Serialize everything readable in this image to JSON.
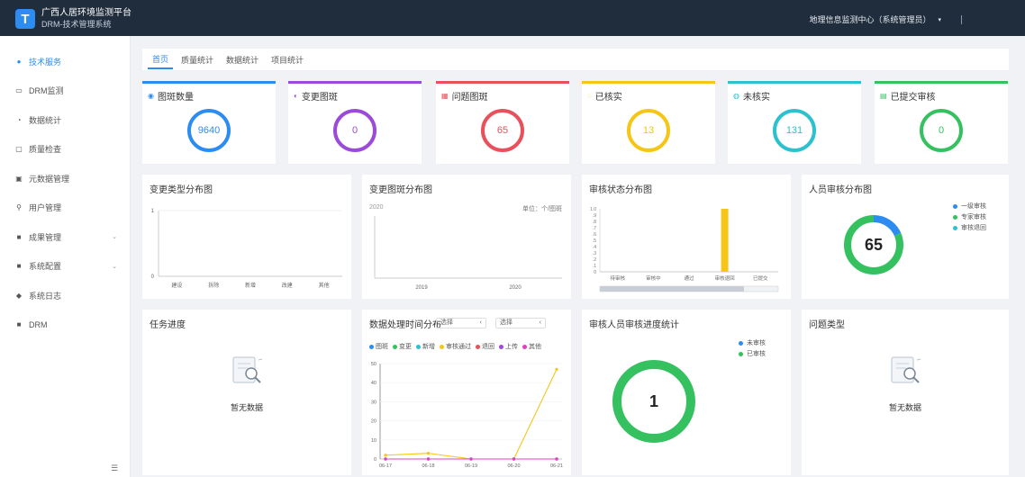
{
  "header": {
    "logo_letter": "T",
    "title_line1": "广西人居环境监测平台",
    "title_line2": "DRM-技术管理系统",
    "user_menu": "地理信息监测中心（系统管理员）",
    "caret": "▾"
  },
  "sidebar": {
    "items": [
      {
        "label": "技术服务",
        "icon": "home-icon",
        "glyph": "●",
        "active": true,
        "has_arrow": false
      },
      {
        "label": "DRM监测",
        "icon": "monitor-icon",
        "glyph": "▭",
        "active": false,
        "has_arrow": false
      },
      {
        "label": "数据统计",
        "icon": "chart-icon",
        "glyph": "◔",
        "active": false,
        "has_arrow": false
      },
      {
        "label": "质量检查",
        "icon": "check-icon",
        "glyph": "▢",
        "active": false,
        "has_arrow": false
      },
      {
        "label": "元数据管理",
        "icon": "database-icon",
        "glyph": "▣",
        "active": false,
        "has_arrow": false
      },
      {
        "label": "用户管理",
        "icon": "user-icon",
        "glyph": "⚲",
        "active": false,
        "has_arrow": false
      },
      {
        "label": "成果管理",
        "icon": "folder-icon",
        "glyph": "■",
        "active": false,
        "has_arrow": true
      },
      {
        "label": "系统配置",
        "icon": "settings-icon",
        "glyph": "■",
        "active": false,
        "has_arrow": true
      },
      {
        "label": "系统日志",
        "icon": "log-icon",
        "glyph": "◆",
        "active": false,
        "has_arrow": false
      },
      {
        "label": "DRM",
        "icon": "doc-icon",
        "glyph": "■",
        "active": false,
        "has_arrow": false
      }
    ],
    "arrow": "⌄",
    "collapse_glyph": "☰"
  },
  "tabs": [
    "首页",
    "质量统计",
    "数据统计",
    "项目统计"
  ],
  "stats": [
    {
      "title": "图斑数量",
      "value": "9640",
      "color": "#2d8cf0",
      "glyph": "◉"
    },
    {
      "title": "变更图斑",
      "value": "0",
      "color": "#9c4ad8",
      "glyph": "◐"
    },
    {
      "title": "问题图斑",
      "value": "65",
      "color": "#e8505b",
      "glyph": "▦"
    },
    {
      "title": "已核实",
      "value": "13",
      "color": "#f5c518",
      "glyph": "◌"
    },
    {
      "title": "未核实",
      "value": "131",
      "color": "#2bc1cf",
      "glyph": "◍"
    },
    {
      "title": "已提交审核",
      "value": "0",
      "color": "#35c160",
      "glyph": "▤"
    }
  ],
  "cards": {
    "c1_title": "变更类型分布图",
    "c2_title": "变更图斑分布图",
    "c2_note": "单位：个/图斑",
    "c2_top_label": "2020",
    "c3_title": "审核状态分布图",
    "c4_title": "人员审核分布图",
    "c5_title": "任务进度",
    "c6_title": "数据处理时间分布",
    "c6_select1": "选择",
    "c6_select2": "选择",
    "c6_select_caret": "‹",
    "c7_title": "审核人员审核进度统计",
    "c8_title": "问题类型",
    "empty_text": "暂无数据"
  },
  "chart_data": [
    {
      "type": "bar",
      "title": "变更类型分布图",
      "categories": [
        "建设",
        "拆除",
        "新增",
        "改建",
        "其他"
      ],
      "values": [
        0,
        0,
        0,
        0,
        0
      ],
      "ylim": [
        0,
        1
      ],
      "yticks": [
        "0",
        "1"
      ]
    },
    {
      "type": "bar",
      "title": "变更图斑分布图",
      "categories": [
        "2019",
        "2020"
      ],
      "values": [
        0,
        0
      ]
    },
    {
      "type": "bar",
      "title": "审核状态分布图",
      "categories": [
        "待审核",
        "审核中",
        "通过",
        "审核退回",
        "已提交"
      ],
      "values": [
        0,
        0,
        0,
        1,
        0
      ],
      "ylim": [
        0,
        1
      ],
      "yticks": [
        "0",
        ".1",
        ".2",
        ".3",
        ".4",
        ".5",
        ".6",
        ".7",
        ".8",
        ".9",
        "1.0"
      ],
      "bar_color": "#f5c518"
    },
    {
      "type": "pie",
      "title": "人员审核分布图",
      "center_label": "65",
      "series": [
        {
          "name": "一级审核",
          "value": 12,
          "color": "#2d8cf0"
        },
        {
          "name": "专家审核",
          "value": 53,
          "color": "#35c160"
        },
        {
          "name": "审核退回",
          "value": 0,
          "color": "#2bc1cf"
        }
      ]
    },
    {
      "type": "line",
      "title": "数据处理时间分布",
      "x": [
        "06-17",
        "06-18",
        "06-19",
        "06-20",
        "06-21"
      ],
      "ylim": [
        0,
        50
      ],
      "yticks": [
        "0",
        "10",
        "20",
        "30",
        "40",
        "50"
      ],
      "series": [
        {
          "name": "图斑",
          "color": "#2d8cf0",
          "values": [
            0,
            0,
            0,
            0,
            0
          ]
        },
        {
          "name": "变更",
          "color": "#35c160",
          "values": [
            0,
            0,
            0,
            0,
            0
          ]
        },
        {
          "name": "新增",
          "color": "#2bc1cf",
          "values": [
            0,
            0,
            0,
            0,
            0
          ]
        },
        {
          "name": "审核通过",
          "color": "#f5c518",
          "values": [
            2,
            3,
            0,
            0,
            47
          ]
        },
        {
          "name": "退回",
          "color": "#e8505b",
          "values": [
            0,
            0,
            0,
            0,
            0
          ]
        },
        {
          "name": "上传",
          "color": "#9c4ad8",
          "values": [
            0,
            0,
            0,
            0,
            0
          ]
        },
        {
          "name": "其他",
          "color": "#e040c0",
          "values": [
            0,
            0,
            0,
            0,
            0
          ]
        }
      ]
    },
    {
      "type": "pie",
      "title": "审核人员审核进度统计",
      "center_label": "1",
      "series": [
        {
          "name": "未审核",
          "value": 0,
          "color": "#2d8cf0"
        },
        {
          "name": "已审核",
          "value": 1,
          "color": "#35c160"
        }
      ]
    }
  ]
}
